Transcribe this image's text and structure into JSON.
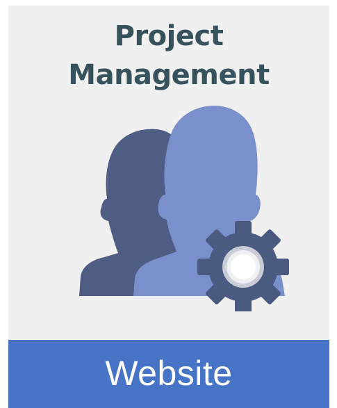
{
  "tile": {
    "title_line1": "Project",
    "title_line2": "Management",
    "illustration_icon": "users-with-gear-icon",
    "button_label": "Website"
  },
  "colors": {
    "tile_background": "#f0f0f0",
    "title_text": "#36525d",
    "footer_background": "#4874c8",
    "footer_text": "#ffffff",
    "person_back": "#4f5c84",
    "person_front": "#7a90cc",
    "gear": "#4b5a80"
  }
}
